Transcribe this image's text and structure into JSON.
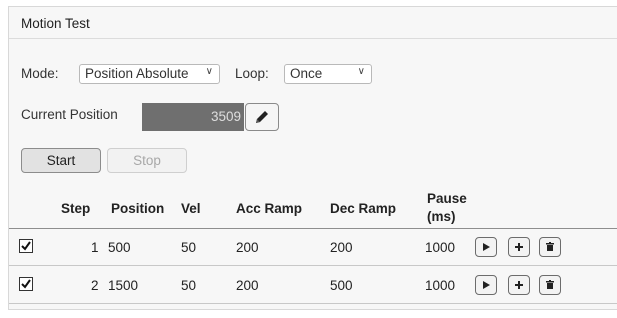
{
  "panel": {
    "title": "Motion Test"
  },
  "mode": {
    "label": "Mode:",
    "value": "Position Absolute"
  },
  "loop": {
    "label": "Loop:",
    "value": "Once"
  },
  "current_position": {
    "label": "Current Position",
    "value": "3509"
  },
  "buttons": {
    "start": "Start",
    "stop": "Stop"
  },
  "table": {
    "headers": {
      "step": "Step",
      "position": "Position",
      "vel": "Vel",
      "acc_ramp": "Acc Ramp",
      "dec_ramp": "Dec Ramp",
      "pause_line1": "Pause",
      "pause_line2": "(ms)"
    },
    "rows": [
      {
        "checked": true,
        "step": "1",
        "position": "500",
        "vel": "50",
        "acc_ramp": "200",
        "dec_ramp": "200",
        "pause": "1000"
      },
      {
        "checked": true,
        "step": "2",
        "position": "1500",
        "vel": "50",
        "acc_ramp": "200",
        "dec_ramp": "500",
        "pause": "1000"
      }
    ]
  },
  "icons": {
    "edit": "pencil-icon",
    "play": "play-icon",
    "add": "plus-icon",
    "delete": "trash-icon",
    "checkbox": "checkmark-icon",
    "dropdown": "chevron-down-icon"
  }
}
